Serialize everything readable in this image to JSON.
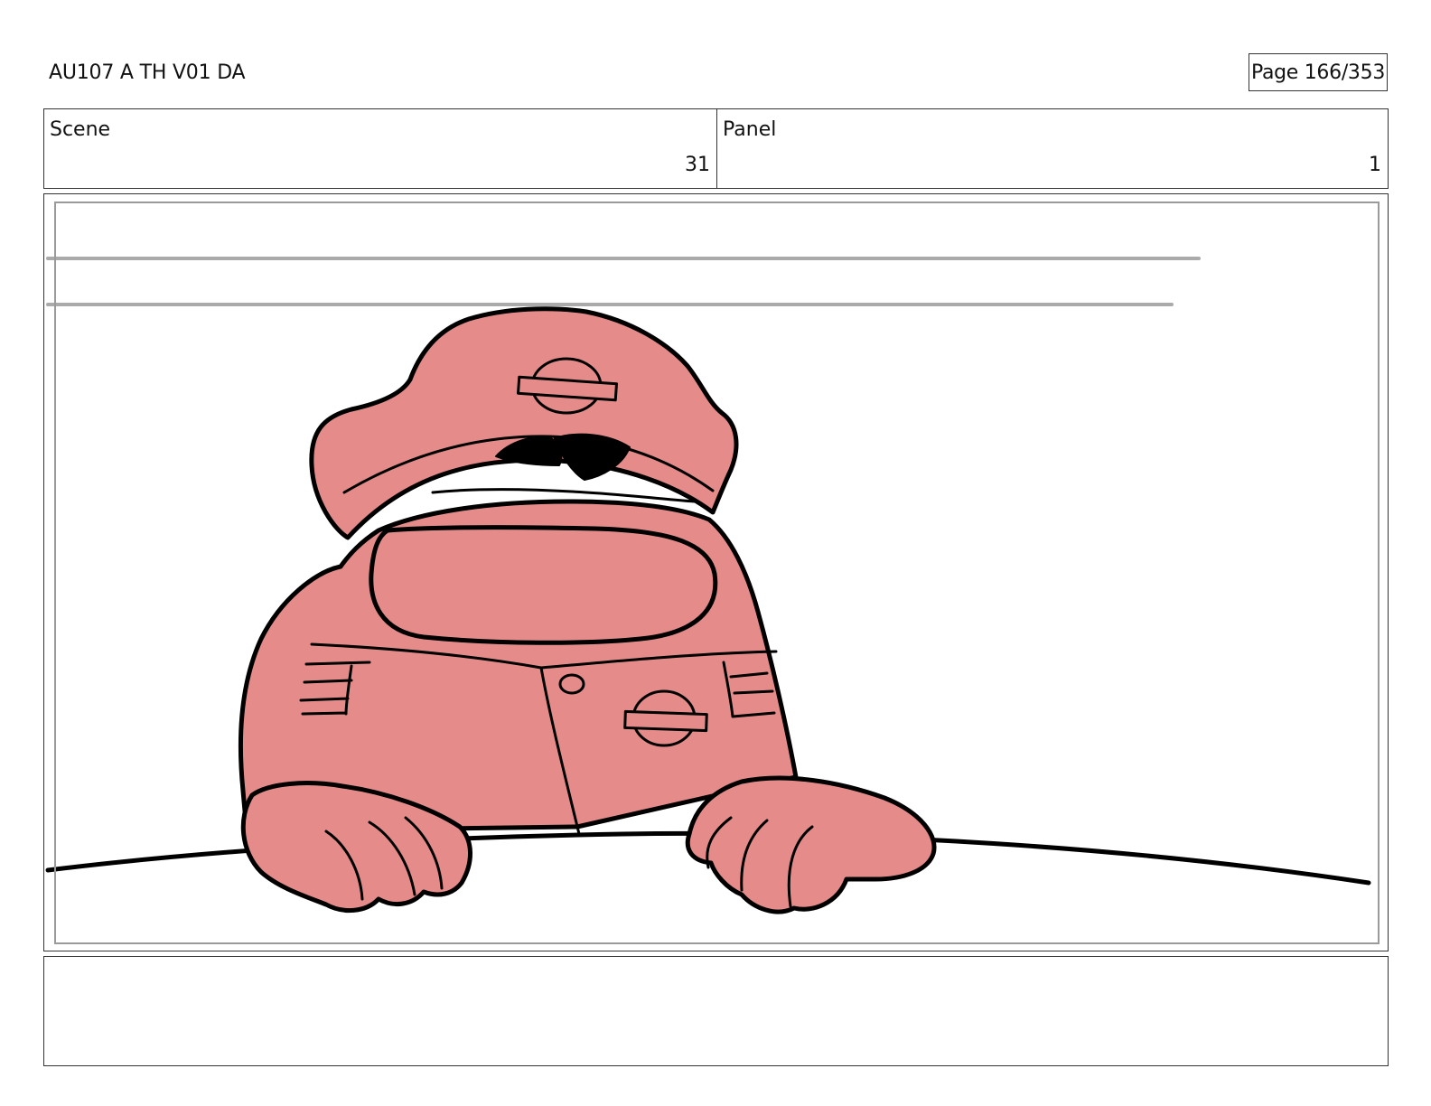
{
  "header": {
    "doc_title": "AU107 A TH V01 DA",
    "page_indicator": "Page 166/353"
  },
  "info": {
    "scene_label": "Scene",
    "scene_value": "31",
    "panel_label": "Panel",
    "panel_value": "1"
  },
  "colors": {
    "character_fill": "#e58c8a",
    "ink": "#000000",
    "speed_lines": "#aaaaaa",
    "border": "#333333"
  },
  "notes": {
    "text": ""
  }
}
